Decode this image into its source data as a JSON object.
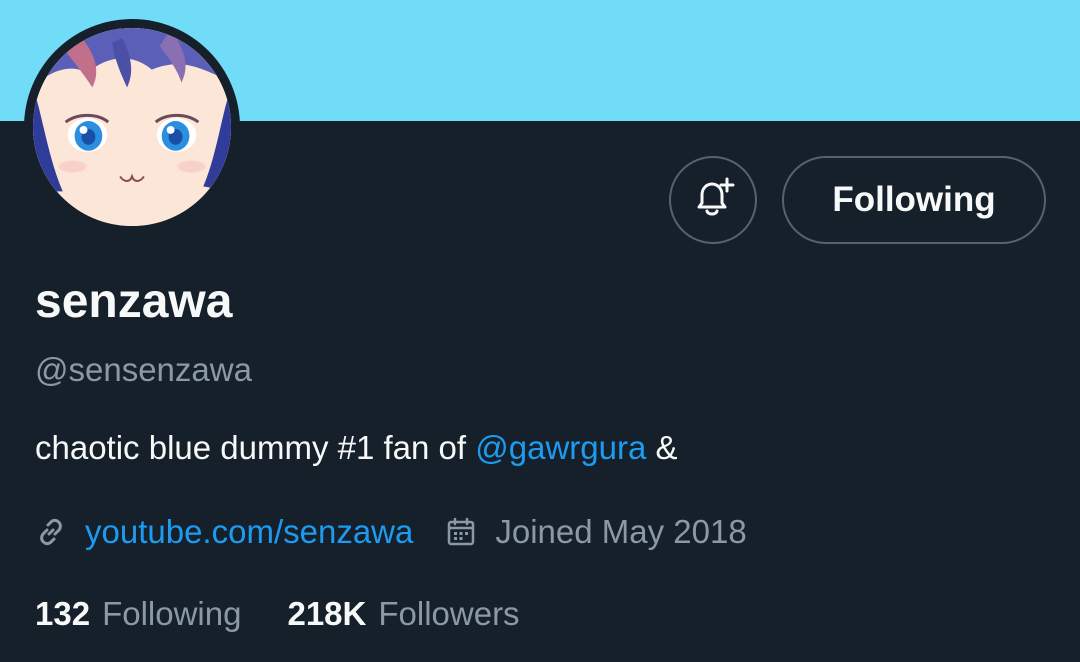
{
  "profile": {
    "display_name": "senzawa",
    "handle": "@sensenzawa",
    "bio_text": "chaotic blue dummy #1 fan of ",
    "bio_mention": "@gawrgura",
    "bio_suffix": " &",
    "website": "youtube.com/senzawa",
    "joined": "Joined May 2018"
  },
  "actions": {
    "notify_icon": "bell-plus-icon",
    "follow_label": "Following"
  },
  "stats": {
    "following_count": "132",
    "following_label": "Following",
    "followers_count": "218K",
    "followers_label": "Followers"
  },
  "icons": {
    "website": "link-icon",
    "joined": "calendar-icon"
  },
  "colors": {
    "banner": "#71dcf7",
    "background": "#15202b",
    "accent_link": "#1d9bf0",
    "secondary_text": "#8b98a5",
    "primary_text": "#f7f9f9",
    "border": "#536471"
  }
}
